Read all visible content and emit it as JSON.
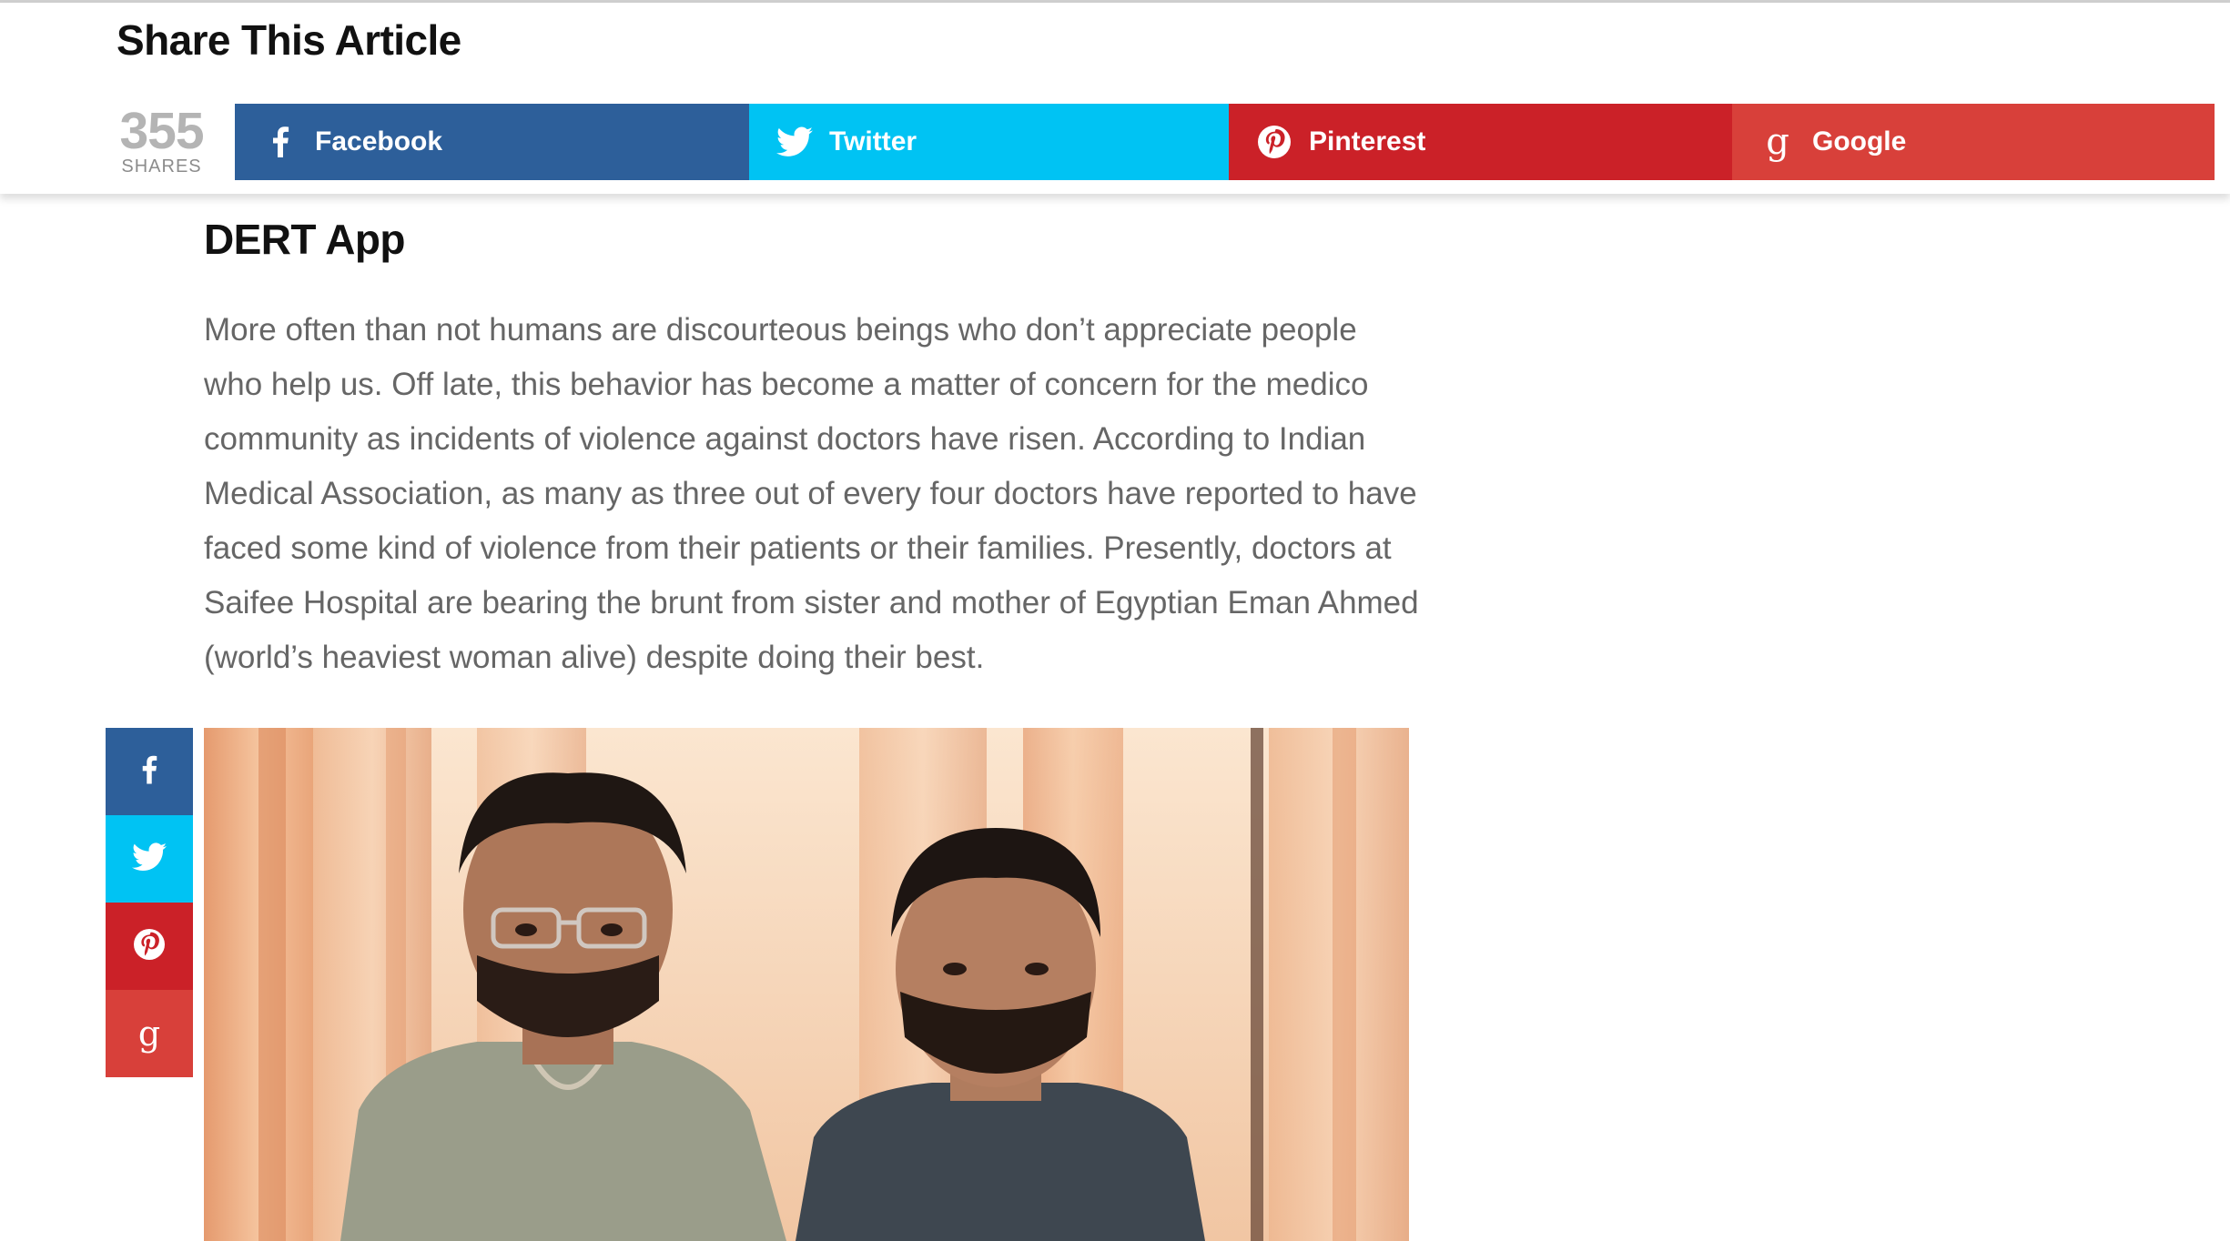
{
  "share_bar": {
    "title": "Share This Article",
    "count": "355",
    "count_label": "SHARES",
    "buttons": [
      {
        "label": "Facebook",
        "icon": "facebook-icon",
        "color": "#2d5f9a"
      },
      {
        "label": "Twitter",
        "icon": "twitter-icon",
        "color": "#00c3f3"
      },
      {
        "label": "Pinterest",
        "icon": "pinterest-icon",
        "color": "#cb2128"
      },
      {
        "label": "Google",
        "icon": "google-plus-icon",
        "color": "#d8403a"
      }
    ]
  },
  "side_share": [
    {
      "icon": "facebook-icon",
      "color": "#2d5f9a"
    },
    {
      "icon": "twitter-icon",
      "color": "#00c3f3"
    },
    {
      "icon": "pinterest-icon",
      "color": "#cb2128"
    },
    {
      "icon": "google-plus-icon",
      "color": "#d8403a"
    }
  ],
  "article": {
    "heading": "DERT App",
    "paragraph": "More often than not humans are discourteous beings who don’t appreciate people who help us. Off late, this behavior has become a matter of concern for the medico community as incidents of violence against doctors have risen. According to Indian Medical Association, as many as three out of every four doctors have reported to have faced some kind of violence from their patients or their families. Presently, doctors at Saifee Hospital are bearing the brunt from sister and mother of Egyptian Eman Ahmed (world’s heaviest woman alive) despite doing their best.",
    "image_subject": "two young men standing in front of orange curtains"
  }
}
